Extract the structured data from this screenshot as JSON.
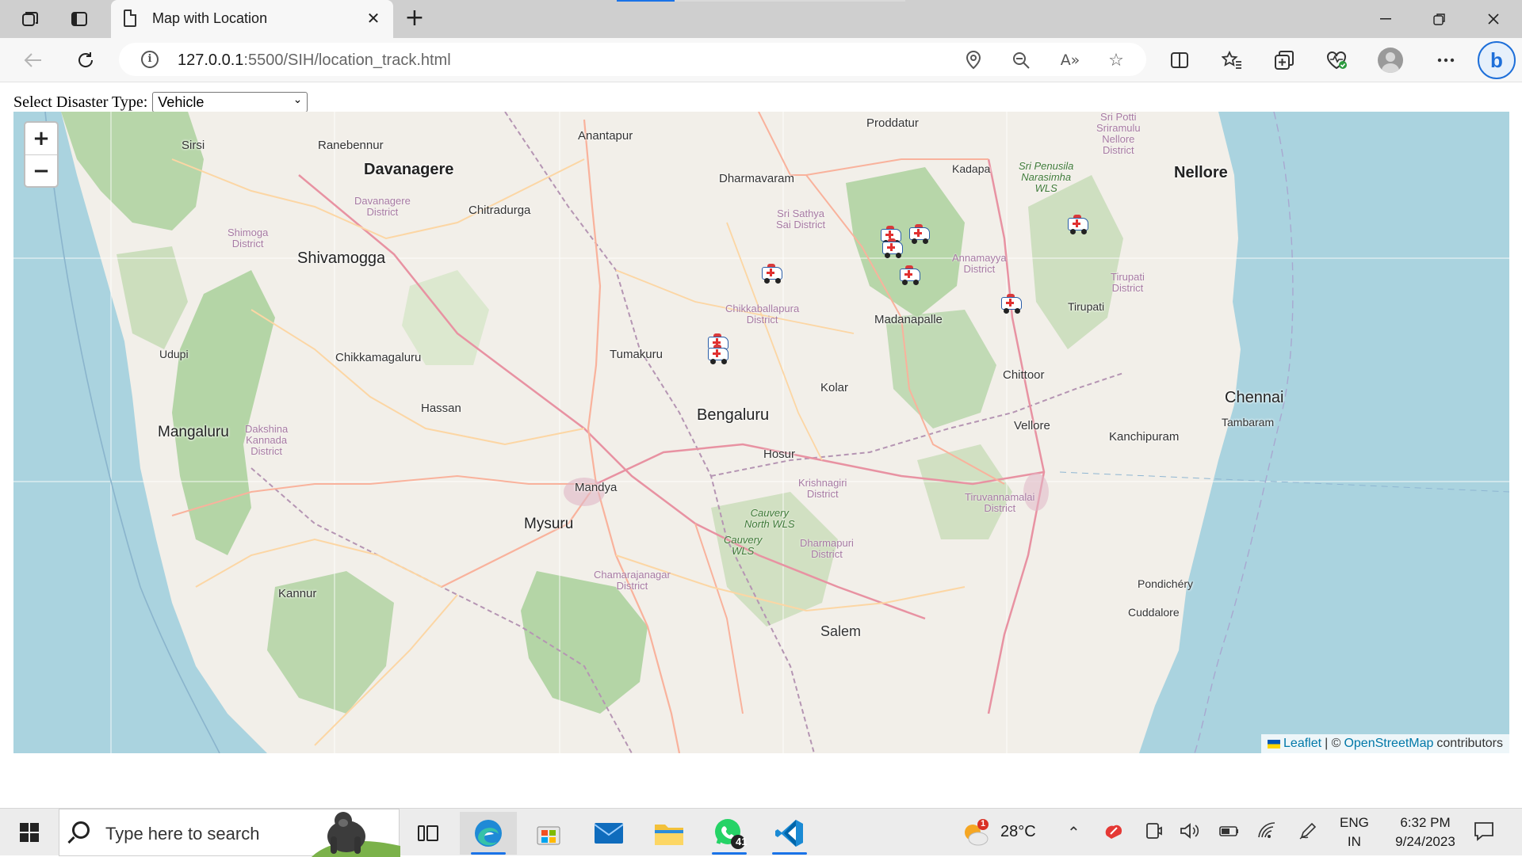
{
  "browser": {
    "tab_title": "Map with Location",
    "url_host": "127.0.0.1",
    "url_path": ":5500/SIH/location_track.html",
    "progress": 0.2
  },
  "page": {
    "select_label": "Select Disaster Type:",
    "selected_type": "Vehicle"
  },
  "map": {
    "zoom_in": "+",
    "zoom_out": "−",
    "cities": {
      "proddatur": "Proddatur",
      "anantapur": "Anantapur",
      "sirsi": "Sirsi",
      "ranebennur": "Ranebennur",
      "davanagere": "Davanagere",
      "dharmavaram": "Dharmavaram",
      "kadapa": "Kadapa",
      "nellore": "Nellore",
      "chitradurga": "Chitradurga",
      "shivamogga": "Shivamogga",
      "madanapalle": "Madanapalle",
      "tirupati": "Tirupati",
      "udupi": "Udupi",
      "chikkamagaluru": "Chikkamagaluru",
      "tumakuru": "Tumakuru",
      "chittoor": "Chittoor",
      "kolar": "Kolar",
      "chennai": "Chennai",
      "hassan": "Hassan",
      "bengaluru": "Bengaluru",
      "tambaram": "Tambaram",
      "vellore": "Vellore",
      "mangaluru": "Mangaluru",
      "kanchipuram": "Kanchipuram",
      "hosur": "Hosur",
      "mandya": "Mandya",
      "mysuru": "Mysuru",
      "kannur": "Kannur",
      "pondichery": "Pondichéry",
      "cuddalore": "Cuddalore",
      "salem": "Salem"
    },
    "districts": {
      "sri_potti": "Sri Potti\nSriramulu\nNellore\nDistrict",
      "davanagere": "Davanagere\nDistrict",
      "shimoga": "Shimoga\nDistrict",
      "sri_sathya": "Sri Sathya\nSai District",
      "annamayya": "Annamayya\nDistrict",
      "tirupati": "Tirupati\nDistrict",
      "chikkaballapura": "Chikkaballapura\nDistrict",
      "dakshina": "Dakshina\nKannada\nDistrict",
      "krishnagiri": "Krishnagiri\nDistrict",
      "tiruvannamalai": "Tiruvannamalai\nDistrict",
      "dharmapuri": "Dharmapuri\nDistrict",
      "chamarajanagar": "Chamarajanagar\nDistrict"
    },
    "parks": {
      "penusila": "Sri Penusila\nNarasimha\nWLS",
      "cauvery_north": "Cauvery\nNorth WLS",
      "cauvery": "Cauvery\nWLS"
    },
    "attribution": {
      "leaflet": "Leaflet",
      "sep": "| ©",
      "osm": "OpenStreetMap",
      "contributors": "contributors"
    }
  },
  "taskbar": {
    "search_placeholder": "Type here to search",
    "weather_badge": "1",
    "temperature": "28°C",
    "whatsapp_badge": "41",
    "lang_1": "ENG",
    "lang_2": "IN",
    "time": "6:32 PM",
    "date": "9/24/2023"
  }
}
